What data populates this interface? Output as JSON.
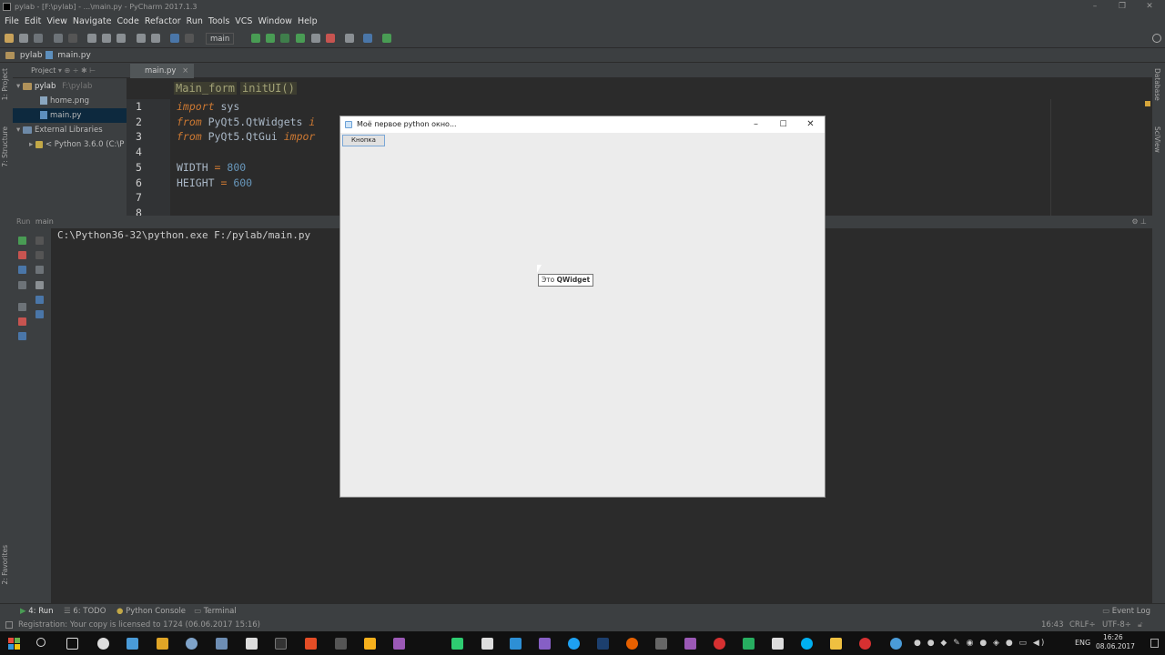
{
  "ide": {
    "window_title": "pylab - [F:\\pylab] - ...\\main.py - PyCharm 2017.1.3",
    "menu": [
      "File",
      "Edit",
      "View",
      "Navigate",
      "Code",
      "Refactor",
      "Run",
      "Tools",
      "VCS",
      "Window",
      "Help"
    ],
    "run_config": "main",
    "navbar": {
      "project": "pylab",
      "file": "main.py"
    },
    "project_panel": {
      "header": "Project",
      "items": [
        {
          "label": "pylab",
          "path": "F:\\pylab"
        },
        {
          "label": "home.png"
        },
        {
          "label": "main.py"
        },
        {
          "label": "External Libraries"
        },
        {
          "label": "< Python 3.6.0 (C:\\P"
        }
      ]
    },
    "editor": {
      "tab": "main.py",
      "breadcrumbs": [
        "Main_form",
        "initUI()"
      ],
      "line_numbers": [
        "1",
        "2",
        "3",
        "4",
        "5",
        "6",
        "7",
        "8"
      ],
      "lines": {
        "l1_kw": "import",
        "l1_rest": " sys",
        "l2_kw": "from",
        "l2_rest": " PyQt5.QtWidgets ",
        "l2_tail": "i",
        "l3_kw": "from",
        "l3_rest": " PyQt5.QtGui ",
        "l3_tail": "impor",
        "l5_name": "WIDTH",
        "l5_op": " = ",
        "l5_val": "800",
        "l6_name": "HEIGHT",
        "l6_op": " = ",
        "l6_val": "600"
      }
    },
    "run_panel": {
      "header": "Run",
      "config": "main",
      "console": "C:\\Python36-32\\python.exe F:/pylab/main.py"
    },
    "tool_windows": [
      "4: Run",
      "6: TODO",
      "Python Console",
      "Terminal"
    ],
    "event_log": "Event Log",
    "left_strip": [
      "1: Project",
      "7: Structure",
      "2: Favorites"
    ],
    "right_strip": [
      "Database",
      "SciView"
    ],
    "status": {
      "message": "Registration: Your copy is licensed to 1724 (06.06.2017 15:16)",
      "position": "16:43",
      "line_sep": "CRLF÷",
      "encoding": "UTF-8÷"
    }
  },
  "qt_window": {
    "title": "Моё первое python окно...",
    "button_label": "Кнопка",
    "tooltip_prefix": "Это ",
    "tooltip_bold": "QWidget"
  },
  "taskbar": {
    "lang": "ENG",
    "time": "16:26",
    "date": "08.06.2017"
  }
}
